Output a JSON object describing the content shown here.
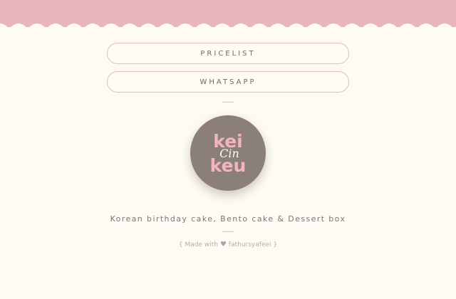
{
  "links": {
    "pricelist": "PRICELIST",
    "whatsapp": "WHATSAPP"
  },
  "logo": {
    "line1": "kei",
    "line2": "Cin",
    "line3": "keu",
    "background_color": "#8b7f79",
    "text_color": "#f2b5c0"
  },
  "tagline": "Korean birthday cake, Bento cake & Dessert box",
  "credit": {
    "prefix": "Made with",
    "icon": "heart-icon",
    "author": "fathursyafeei",
    "open_bracket": "{",
    "close_bracket": "}"
  },
  "colors": {
    "header_pink": "#e9b5ba",
    "page_background": "#fdfbf4",
    "button_border": "#e3bcc4"
  }
}
